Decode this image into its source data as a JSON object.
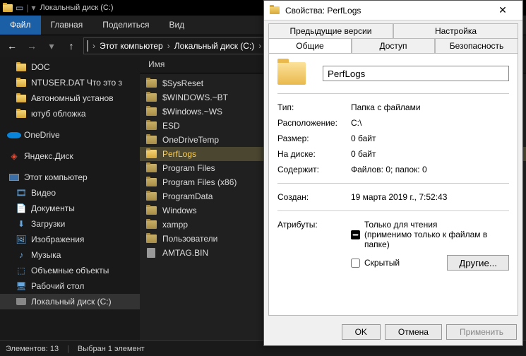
{
  "explorer": {
    "title": "Локальный диск (C:)",
    "tabs": {
      "file": "Файл",
      "home": "Главная",
      "share": "Поделиться",
      "view": "Вид"
    },
    "breadcrumb": {
      "pc": "Этот компьютер",
      "drive": "Локальный диск (C:)"
    },
    "nav": {
      "quick": [
        {
          "label": "DOC"
        },
        {
          "label": "NTUSER.DAT Что это з"
        },
        {
          "label": "Автономный установ"
        },
        {
          "label": "ютуб обложка"
        }
      ],
      "onedrive": "OneDrive",
      "yandex": "Яндекс.Диск",
      "thispc": "Этот компьютер",
      "pc_items": [
        "Видео",
        "Документы",
        "Загрузки",
        "Изображения",
        "Музыка",
        "Объемные объекты",
        "Рабочий стол",
        "Локальный диск (C:)"
      ]
    },
    "columns": {
      "name": "Имя"
    },
    "files": [
      {
        "name": "$SysReset",
        "type": "folder"
      },
      {
        "name": "$WINDOWS.~BT",
        "type": "folder"
      },
      {
        "name": "$Windows.~WS",
        "type": "folder"
      },
      {
        "name": "ESD",
        "type": "folder"
      },
      {
        "name": "OneDriveTemp",
        "type": "folder"
      },
      {
        "name": "PerfLogs",
        "type": "folder",
        "selected": true
      },
      {
        "name": "Program Files",
        "type": "folder"
      },
      {
        "name": "Program Files (x86)",
        "type": "folder"
      },
      {
        "name": "ProgramData",
        "type": "folder"
      },
      {
        "name": "Windows",
        "type": "folder"
      },
      {
        "name": "xampp",
        "type": "folder"
      },
      {
        "name": "Пользователи",
        "type": "folder"
      },
      {
        "name": "AMTAG.BIN",
        "type": "file"
      }
    ],
    "status": {
      "count": "Элементов: 13",
      "selected": "Выбран 1 элемент"
    }
  },
  "props": {
    "title": "Свойства: PerfLogs",
    "tabs": {
      "prev": "Предыдущие версии",
      "custom": "Настройка",
      "general": "Общие",
      "sharing": "Доступ",
      "security": "Безопасность"
    },
    "name": "PerfLogs",
    "rows": {
      "type_l": "Тип:",
      "type_v": "Папка с файлами",
      "loc_l": "Расположение:",
      "loc_v": "C:\\",
      "size_l": "Размер:",
      "size_v": "0 байт",
      "disk_l": "На диске:",
      "disk_v": "0 байт",
      "contains_l": "Содержит:",
      "contains_v": "Файлов: 0; папок: 0",
      "created_l": "Создан:",
      "created_v": "19 марта 2019 г., 7:52:43",
      "attr_l": "Атрибуты:"
    },
    "attrs": {
      "readonly": "Только для чтения",
      "readonly_sub": "(применимо только к файлам в папке)",
      "hidden": "Скрытый",
      "others": "Другие..."
    },
    "buttons": {
      "ok": "OK",
      "cancel": "Отмена",
      "apply": "Применить"
    }
  }
}
